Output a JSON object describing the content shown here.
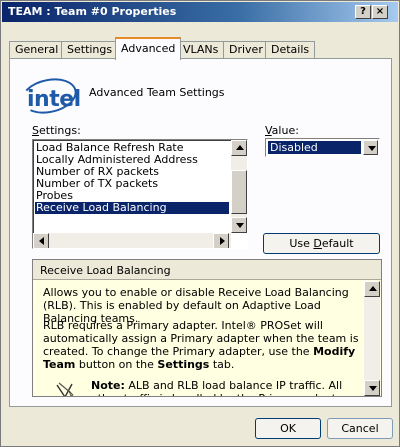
{
  "window": {
    "title": "TEAM : Team #0 Properties",
    "help_button": "?",
    "close_button": "×"
  },
  "tabs": [
    {
      "label": "General"
    },
    {
      "label": "Settings"
    },
    {
      "label": "Advanced"
    },
    {
      "label": "VLANs"
    },
    {
      "label": "Driver"
    },
    {
      "label": "Details"
    }
  ],
  "active_tab": "Advanced",
  "logo": {
    "text": "intel",
    "icon": "intel-logo"
  },
  "heading": "Advanced Team Settings",
  "settings": {
    "label_u": "S",
    "label_rest": "ettings:",
    "items": [
      "Load Balance Refresh Rate",
      "Locally Administered Address",
      "Number of RX packets",
      "Number of TX packets",
      "Probes",
      "Receive Load Balancing"
    ],
    "selected": "Receive Load Balancing"
  },
  "value": {
    "label_u": "V",
    "label_rest": "alue:",
    "selected": "Disabled"
  },
  "use_default_button": {
    "pre": "Use ",
    "u": "D",
    "rest": "efault"
  },
  "description": {
    "header": "Receive Load Balancing",
    "para1": "Allows you to enable or disable Receive Load Balancing (RLB). This is enabled by default on Adaptive Load Balancing teams.",
    "para2_a": "RLB requires a Primary adapter. Intel® PROSet will automatically assign a Primary adapter when the team is created. To change the Primary adapter, use the ",
    "para2_bold1": "Modify Team",
    "para2_b": " button on the ",
    "para2_bold2": "Settings",
    "para2_c": " tab.",
    "note_label": "Note:",
    "note_text": " ALB and RLB load balance IP traffic. All other traffic is handled by the Primary adapter.",
    "note_icon": "note-pencil-icon"
  },
  "buttons": {
    "ok": "OK",
    "cancel": "Cancel"
  },
  "colors": {
    "titlebar": "#0a246a",
    "selection": "#0a246a",
    "info_background": "#ffffe1",
    "active_tab_accent": "#e68b2c",
    "intel_blue": "#1e5aa8"
  }
}
